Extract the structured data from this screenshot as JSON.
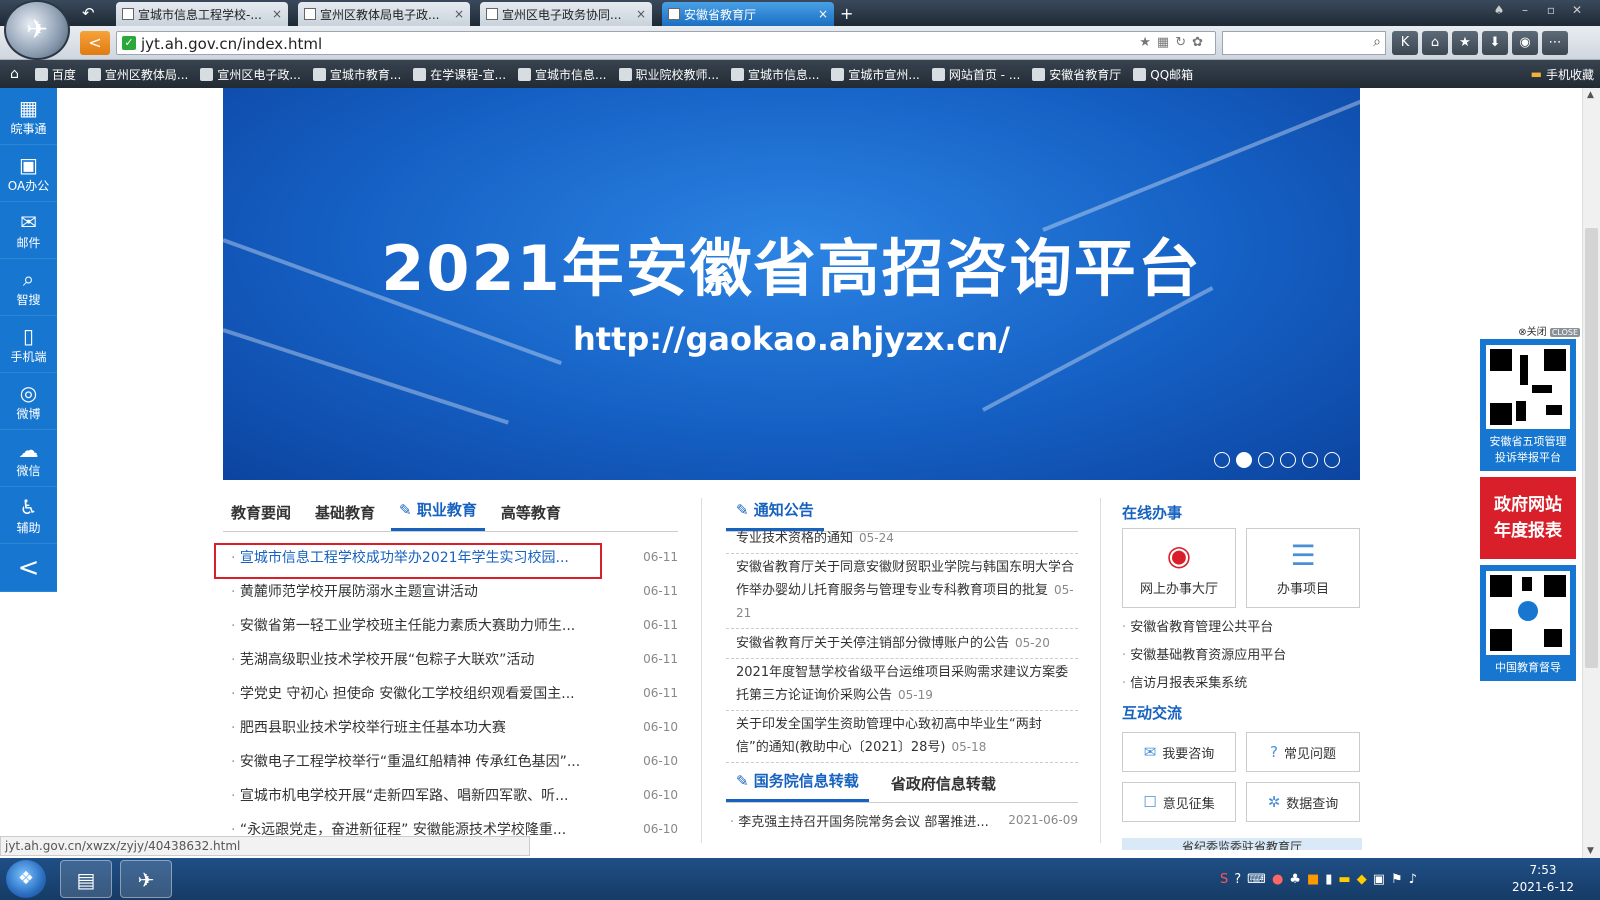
{
  "browser": {
    "tabs": [
      {
        "label": "宣城市信息工程学校-..."
      },
      {
        "label": "宣州区教体局电子政..."
      },
      {
        "label": "宣州区电子政务协同..."
      },
      {
        "label": "安徽省教育厅"
      }
    ],
    "close_glyph": "×",
    "new_tab_glyph": "+",
    "address": "jyt.ah.gov.cn/index.html",
    "bookmarks": [
      "百度",
      "宣州区教体局...",
      "宣州区电子政...",
      "宣城市教育...",
      "在学课程-宣...",
      "宣城市信息...",
      "职业院校教师...",
      "宣城市信息...",
      "宣城市宣州...",
      "网站首页 - ...",
      "安徽省教育厅",
      "QQ邮箱"
    ],
    "bookmark_folder": "手机收藏",
    "status_url": "jyt.ah.gov.cn/xwzx/zyjy/40438632.html"
  },
  "sidebar": {
    "items": [
      "皖事通",
      "OA办公",
      "邮件",
      "智搜",
      "手机端",
      "微博",
      "微信",
      "辅助"
    ],
    "collapse_glyph": "<"
  },
  "banner": {
    "title": "2021年安徽省高招咨询平台",
    "link": "http://gaokao.ahjyzx.cn/",
    "slide_count": 6,
    "active_slide": 2
  },
  "news": {
    "tabs": [
      "教育要闻",
      "基础教育",
      "职业教育",
      "高等教育"
    ],
    "active_tab": "职业教育",
    "items": [
      {
        "title": "宣城市信息工程学校成功举办2021年学生实习校园...",
        "date": "06-11"
      },
      {
        "title": "黄麓师范学校开展防溺水主题宣讲活动",
        "date": "06-11"
      },
      {
        "title": "安徽省第一轻工业学校班主任能力素质大赛助力师生...",
        "date": "06-11"
      },
      {
        "title": "芜湖高级职业技术学校开展“包粽子大联欢”活动",
        "date": "06-11"
      },
      {
        "title": "学党史 守初心 担使命 安徽化工学校组织观看爱国主...",
        "date": "06-11"
      },
      {
        "title": "肥西县职业技术学校举行班主任基本功大赛",
        "date": "06-10"
      },
      {
        "title": "安徽电子工程学校举行“重温红船精神 传承红色基因”...",
        "date": "06-10"
      },
      {
        "title": "宣城市机电学校开展“走新四军路、唱新四军歌、听...",
        "date": "06-10"
      },
      {
        "title": "“永远跟党走，奋进新征程” 安徽能源技术学校隆重...",
        "date": "06-10"
      }
    ]
  },
  "notices": {
    "title": "通知公告",
    "items": [
      {
        "title": "专业技术资格的通知",
        "date": "05-24"
      },
      {
        "title": "安徽省教育厅关于同意安徽财贸职业学院与韩国东明大学合作举办婴幼儿托育服务与管理专业专科教育项目的批复",
        "date": "05-21"
      },
      {
        "title": "安徽省教育厅关于关停注销部分微博账户的公告",
        "date": "05-20"
      },
      {
        "title": "2021年度智慧学校省级平台运维项目采购需求建议方案委托第三方论证询价采购公告",
        "date": "05-19"
      },
      {
        "title": "关于印发全国学生资助管理中心致初高中毕业生“两封信”的通知(教助中心〔2021〕28号)",
        "date": "05-18"
      }
    ],
    "sub_tabs": [
      "国务院信息转载",
      "省政府信息转载"
    ],
    "sub_items": [
      {
        "title": "李克强主持召开国务院常务会议 部署推进...",
        "date": "2021-06-09"
      }
    ]
  },
  "service": {
    "title": "在线办事",
    "big_buttons": [
      "网上办事大厅",
      "办事项目"
    ],
    "links": [
      "安徽省教育管理公共平台",
      "安徽基础教育资源应用平台",
      "信访月报表采集系统"
    ],
    "interact_title": "互动交流",
    "small_buttons": [
      "我要咨询",
      "常见问题",
      "意见征集",
      "数据查询"
    ],
    "bottom_text": "省纪委监委驻省教育厅"
  },
  "right_ads": {
    "close_label": "⊗关闭",
    "close_badge": "CLOSE",
    "qr1_caption": "安徽省五项管理投诉举报平台",
    "red_ad_line1": "政府网站",
    "red_ad_line2": "年度报表",
    "qr2_caption": "中国教育督导"
  },
  "taskbar": {
    "time": "7:53",
    "date": "2021-6-12"
  },
  "colors": {
    "brand_blue": "#1762c0",
    "sidebar_blue": "#1777d0",
    "highlight_red": "#d9202a"
  }
}
